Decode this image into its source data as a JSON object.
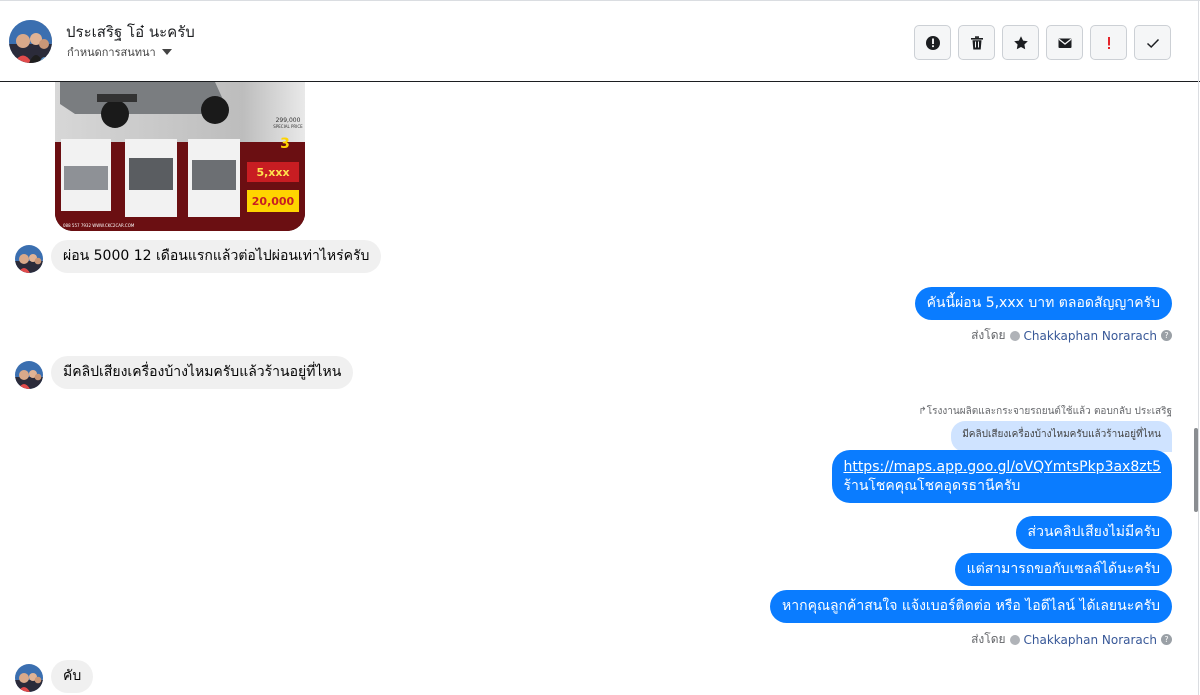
{
  "header": {
    "name": "ประเสริฐ โอ๋ นะครับ",
    "subtitle": "กำหนดการสนทนา",
    "actions": [
      {
        "name": "report-icon",
        "label": "!"
      },
      {
        "name": "trash-icon"
      },
      {
        "name": "star-icon"
      },
      {
        "name": "mail-icon"
      },
      {
        "name": "exclamation-icon",
        "label": "!"
      },
      {
        "name": "check-icon"
      }
    ]
  },
  "product_image": {
    "price_label": "299,000",
    "price_caption": "SPECIAL PRICE",
    "installment": "5,xxx",
    "down": "20,000",
    "years": "3",
    "phone": "088 557 7932 WWW.CKC2CAR.COM"
  },
  "messages": [
    {
      "dir": "in",
      "text": "ผ่อน 5000 12 เดือนแรกแล้วต่อไปผ่อนเท่าไหร่ครับ"
    },
    {
      "dir": "out",
      "text": "คันนี้ผ่อน 5,xxx บาท ตลอดสัญญาครับ"
    },
    {
      "dir": "in",
      "text": "มีคลิปเสียงเครื่องบ้างไหมครับแล้วร้านอยู่ที่ไหน"
    },
    {
      "dir": "out",
      "link": "https://maps.app.goo.gl/oVQYmtsPkp3ax8zt5",
      "text": "ร้านโชคคุณโชคอุดรธานีครับ"
    },
    {
      "dir": "out",
      "text": "ส่วนคลิปเสียงไม่มีครับ"
    },
    {
      "dir": "out",
      "text": "แต่สามารถขอกับเซลล์ได้นะครับ"
    },
    {
      "dir": "out",
      "text": "หากคุณลูกค้าสนใจ แจ้งเบอร์ติดต่อ หรือ ไอดีไลน์ ได้เลยนะครับ"
    },
    {
      "dir": "in",
      "text": "คับ"
    }
  ],
  "sent_by": {
    "prefix": "ส่งโดย",
    "name": "Chakkaphan Norarach"
  },
  "reply": {
    "note": "↱โรงงานผลิตและกระจายรถยนต์ใช้แล้ว ตอบกลับ ประเสริฐ",
    "quote": "มีคลิปเสียงเครื่องบ้างไหมครับแล้วร้านอยู่ที่ไหน"
  },
  "colors": {
    "outgoing": "#0a7cff",
    "incoming": "#f0f0f0",
    "quote": "#cfe3ff"
  }
}
